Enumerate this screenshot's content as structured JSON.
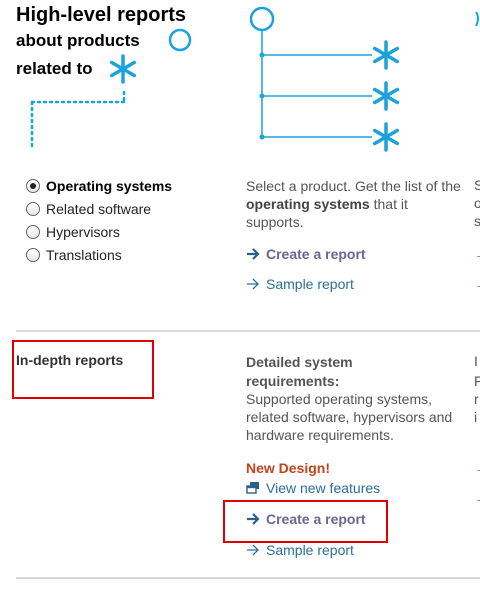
{
  "header": {
    "title": "High-level reports",
    "subtitle_line1": "about products",
    "subtitle_line2": "related to"
  },
  "radio_options": [
    {
      "label": "Operating systems",
      "selected": true
    },
    {
      "label": "Related software",
      "selected": false
    },
    {
      "label": "Hypervisors",
      "selected": false
    },
    {
      "label": "Translations",
      "selected": false
    }
  ],
  "high_level": {
    "description_pre": "Select a product. Get the list of the ",
    "description_bold": "operating systems",
    "description_post": " that it supports.",
    "create_label": "Create a report",
    "sample_label": "Sample report"
  },
  "in_depth": {
    "title": "In-depth reports",
    "heading": "Detailed system requirements:",
    "body": "Supported operating systems, related software, hypervisors and hardware requirements.",
    "new_design": "New Design!",
    "features_label": "View new features",
    "create_label": "Create a report",
    "sample_label": "Sample report"
  },
  "colors": {
    "accent_blue": "#1aa3d9",
    "link_purple": "#6d6596",
    "link_blue": "#2a6f9e",
    "new_design_orange": "#c0441b",
    "highlight_red": "#e00000"
  },
  "icons": [
    "circle-icon",
    "asterisk-icon",
    "arrow-right-icon",
    "external-window-icon"
  ]
}
